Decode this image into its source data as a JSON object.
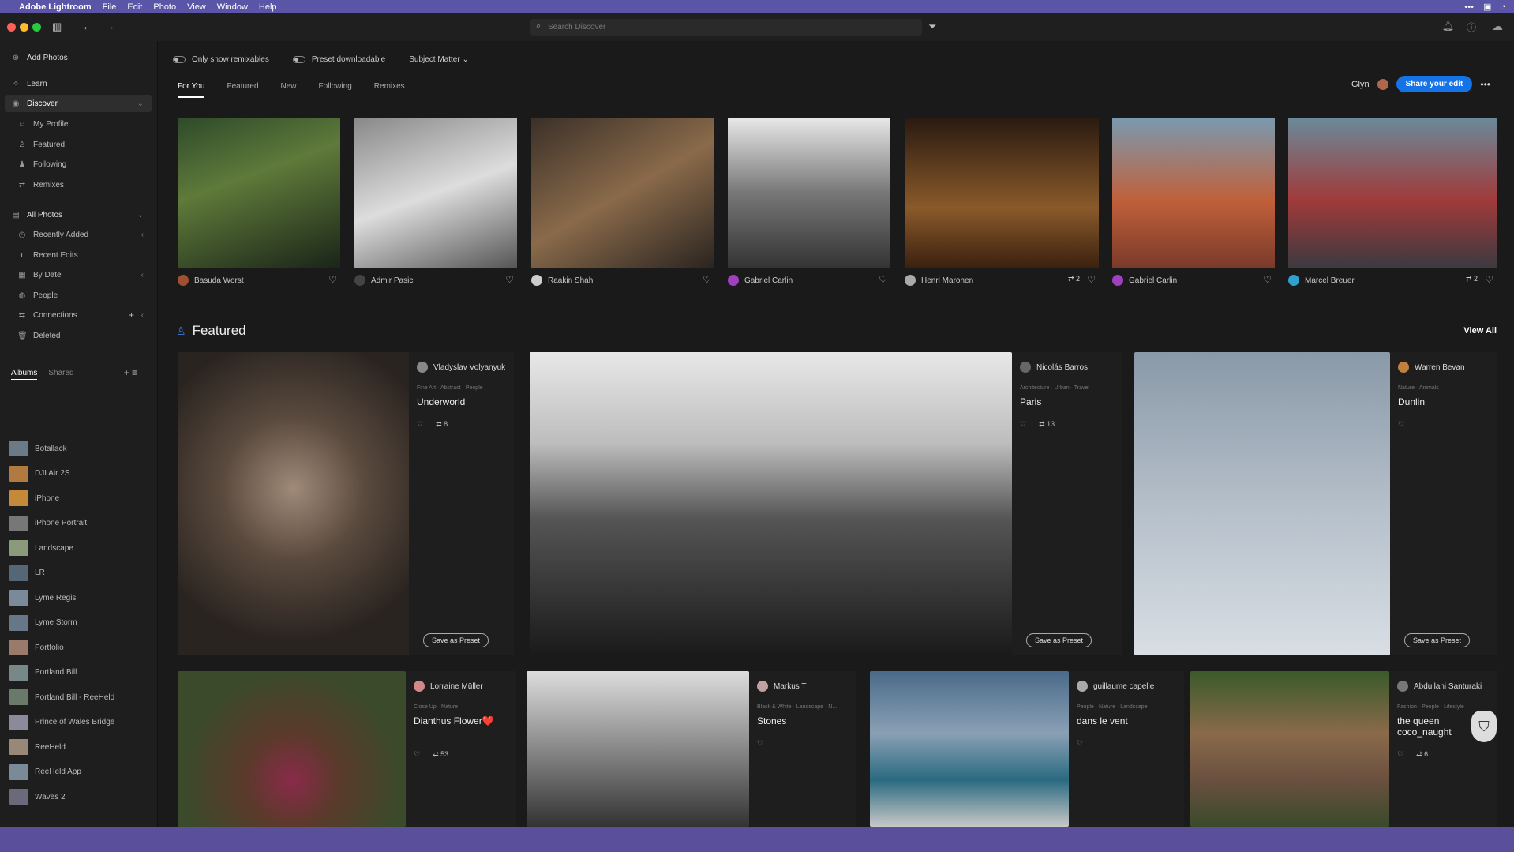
{
  "menubar": {
    "app": "Adobe Lightroom",
    "items": [
      "File",
      "Edit",
      "Photo",
      "View",
      "Window",
      "Help"
    ]
  },
  "search": {
    "placeholder": "Search Discover"
  },
  "sidebar": {
    "add_photos": "Add Photos",
    "learn": "Learn",
    "discover": "Discover",
    "discover_items": [
      "My Profile",
      "Featured",
      "Following",
      "Remixes"
    ],
    "all_photos": "All Photos",
    "all_photos_items": [
      "Recently Added",
      "Recent Edits",
      "By Date",
      "People",
      "Connections",
      "Deleted"
    ],
    "albums_tab": "Albums",
    "shared_tab": "Shared",
    "albums": [
      {
        "name": "Botallack",
        "color": "#6a7a86"
      },
      {
        "name": "DJI Air 2S",
        "color": "#b07a40"
      },
      {
        "name": "iPhone",
        "color": "#c48a3a"
      },
      {
        "name": "iPhone Portrait",
        "color": "#777"
      },
      {
        "name": "Landscape",
        "color": "#8a9a7a"
      },
      {
        "name": "LR",
        "color": "#556677"
      },
      {
        "name": "Lyme Regis",
        "color": "#7a8a9a"
      },
      {
        "name": "Lyme Storm",
        "color": "#667788"
      },
      {
        "name": "Portfolio",
        "color": "#9a7a6a"
      },
      {
        "name": "Portland Bill",
        "color": "#778888"
      },
      {
        "name": "Portland Bill - ReeHeld",
        "color": "#6a7a6a"
      },
      {
        "name": "Prince of Wales Bridge",
        "color": "#8a8a9a"
      },
      {
        "name": "ReeHeld",
        "color": "#998877"
      },
      {
        "name": "ReeHeld App",
        "color": "#7a8a99"
      },
      {
        "name": "Waves 2",
        "color": "#6a6a7a"
      }
    ]
  },
  "options": {
    "remixables": "Only show remixables",
    "downloadable": "Preset downloadable",
    "subject": "Subject Matter"
  },
  "tabs": [
    "For You",
    "Featured",
    "New",
    "Following",
    "Remixes"
  ],
  "user": {
    "name": "Glyn",
    "share": "Share your edit"
  },
  "top_row": [
    {
      "author": "Basuda Worst",
      "bg": "linear-gradient(160deg,#2e4a2a,#5f7a3a 40%,#1a2418)",
      "av": "#a05030"
    },
    {
      "author": "Admir Pasic",
      "bg": "linear-gradient(160deg,#888,#ddd 50%,#555)",
      "av": "#444"
    },
    {
      "author": "Raakin Shah",
      "bg": "linear-gradient(150deg,#3a3028,#8a6a4a 50%,#2a2420)",
      "av": "#ccc"
    },
    {
      "author": "Gabriel Carlin",
      "bg": "linear-gradient(180deg,#e8e8e8,#777 50%,#333)",
      "av": "#a040c0"
    },
    {
      "author": "Henri Maronen",
      "bg": "linear-gradient(180deg,#2a1a10,#8a5a2a 60%,#3a2010)",
      "av": "#aaa",
      "remix": "2"
    },
    {
      "author": "Gabriel Carlin",
      "bg": "linear-gradient(180deg,#7a9ab0,#c0603a 55%,#7a3a2a)",
      "av": "#a040c0"
    },
    {
      "author": "Marcel Breuer",
      "bg": "linear-gradient(180deg,#6a8a9a,#a03a3a 55%,#3a3a40)",
      "av": "#30a0d0",
      "remix": "2"
    }
  ],
  "featured": {
    "title": "Featured",
    "view_all": "View All",
    "items": [
      {
        "author": "Vladyslav Volyanyuk",
        "tags": "Fine Art · Abstract · People",
        "name": "Underworld",
        "remix": "8",
        "preset": "Save as Preset"
      },
      {
        "author": "Nicolás Barros",
        "tags": "Architecture · Urban · Travel",
        "name": "Paris",
        "remix": "13",
        "preset": "Save as Preset"
      },
      {
        "author": "Warren Bevan",
        "tags": "Nature · Animals",
        "name": "Dunlin",
        "preset": "Save as Preset"
      }
    ]
  },
  "row3": [
    {
      "author": "Lorraine Müller",
      "tags": "Close Up · Nature",
      "name": "Dianthus Flower❤️",
      "remix": "53"
    },
    {
      "author": "Markus T",
      "tags": "Black & White · Landscape · N...",
      "name": "Stones"
    },
    {
      "author": "guillaume capelle",
      "tags": "People · Nature · Landscape",
      "name": "dans le vent"
    },
    {
      "author": "Abdullahi Santuraki",
      "tags": "Fashion · People · Lifestyle",
      "name": "the queen coco_naught",
      "remix": "6"
    }
  ]
}
